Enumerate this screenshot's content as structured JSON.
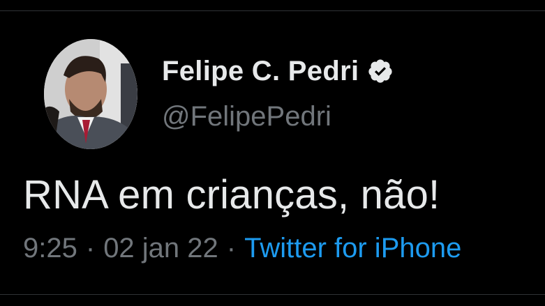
{
  "author": {
    "display_name": "Felipe C. Pedri",
    "handle": "@FelipePedri",
    "verified_icon": "verified-badge-icon",
    "avatar_icon": "profile-photo"
  },
  "tweet": {
    "text": "RNA em crianças, não!",
    "time": "9:25",
    "separator": "·",
    "date": "02 jan 22",
    "source": "Twitter for iPhone"
  },
  "colors": {
    "background": "#000000",
    "primary_text": "#e7e9ea",
    "secondary_text": "#71767b",
    "link": "#1d9bf0",
    "divider": "#2f3336"
  }
}
